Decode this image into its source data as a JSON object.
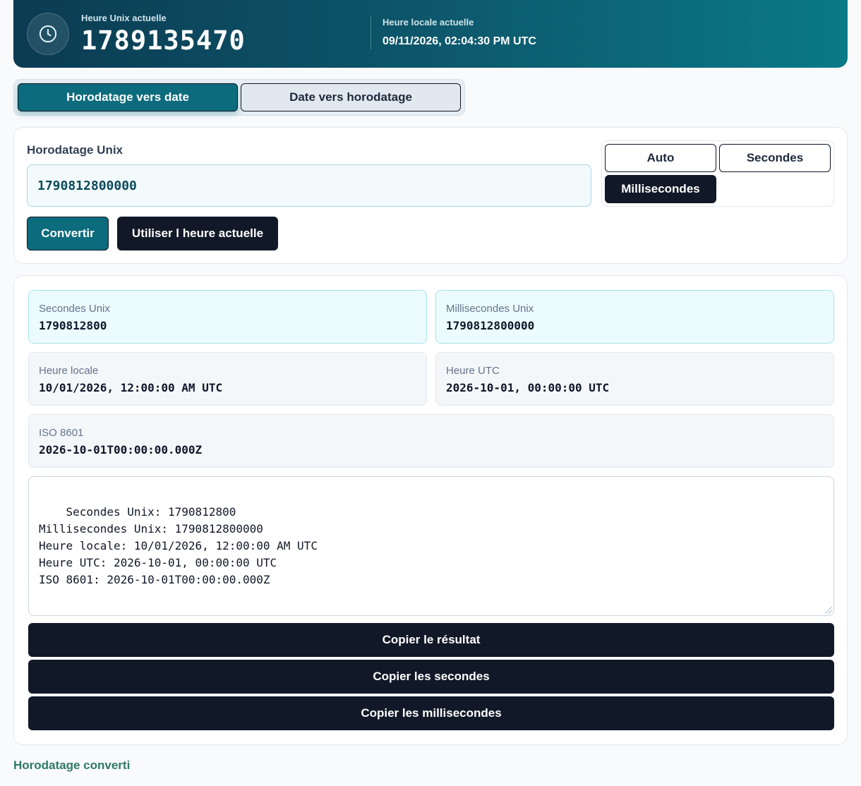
{
  "header": {
    "unix_label": "Heure Unix actuelle",
    "unix_value": "1789135470",
    "local_label": "Heure locale actuelle",
    "local_value": "09/11/2026, 02:04:30 PM UTC",
    "icon": "clock-icon"
  },
  "tabs": [
    {
      "label": "Horodatage vers date",
      "active": true
    },
    {
      "label": "Date vers horodatage",
      "active": false
    }
  ],
  "input": {
    "label": "Horodatage Unix",
    "value": "1790812800000",
    "units": [
      {
        "label": "Auto",
        "selected": false
      },
      {
        "label": "Secondes",
        "selected": false
      },
      {
        "label": "Millisecondes",
        "selected": true
      }
    ],
    "convert_label": "Convertir",
    "now_label": "Utiliser l heure actuelle"
  },
  "results": {
    "seconds": {
      "label": "Secondes Unix",
      "value": "1790812800"
    },
    "milliseconds": {
      "label": "Millisecondes Unix",
      "value": "1790812800000"
    },
    "local": {
      "label": "Heure locale",
      "value": "10/01/2026, 12:00:00 AM UTC"
    },
    "utc": {
      "label": "Heure UTC",
      "value": "2026-10-01, 00:00:00 UTC"
    },
    "iso": {
      "label": "ISO 8601",
      "value": "2026-10-01T00:00:00.000Z"
    },
    "output_text": "Secondes Unix: 1790812800\nMillisecondes Unix: 1790812800000\nHeure locale: 10/01/2026, 12:00:00 AM UTC\nHeure UTC: 2026-10-01, 00:00:00 UTC\nISO 8601: 2026-10-01T00:00:00.000Z",
    "copy_result_label": "Copier le résultat",
    "copy_seconds_label": "Copier les secondes",
    "copy_ms_label": "Copier les millisecondes"
  },
  "footer": {
    "link_label": "Horodatage converti"
  },
  "colors": {
    "accent": "#0c6b7c",
    "dark_button": "#111827",
    "footer_link": "#2f7a62"
  }
}
